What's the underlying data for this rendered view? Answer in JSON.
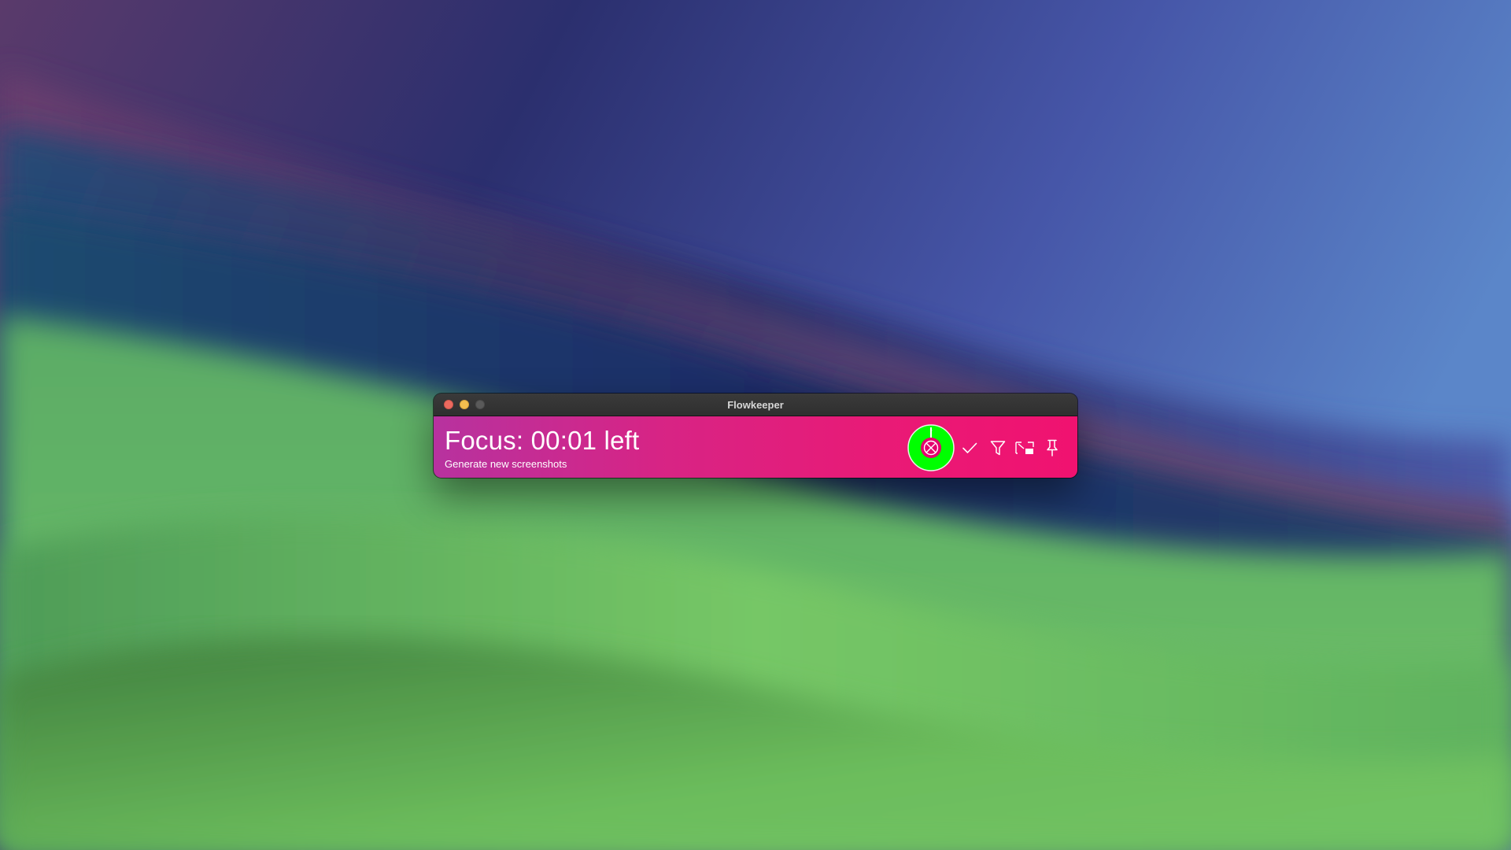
{
  "window": {
    "title": "Flowkeeper"
  },
  "focus": {
    "status_text": "Focus: 00:01 left",
    "work_item": "Generate new screenshots",
    "timer_remaining_fraction": 0.01
  },
  "colors": {
    "accent_green": "#00ff00",
    "bar_gradient_start": "#b7329f",
    "bar_gradient_end": "#f01270"
  },
  "toolbar": {
    "icons": [
      "void-timer-icon",
      "check-icon",
      "filter-icon",
      "resize-icon",
      "pin-icon"
    ]
  }
}
